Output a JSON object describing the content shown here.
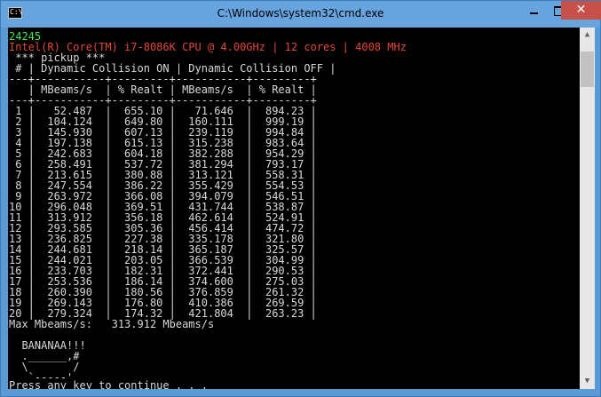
{
  "window": {
    "title": "C:\\Windows\\system32\\cmd.exe",
    "icon_label": "C:\\",
    "minimize_icon": "minimize-icon",
    "maximize_icon": "maximize-icon",
    "close_label": "✕"
  },
  "colors": {
    "titlebar": "#67a3dd",
    "console_bg": "#000000",
    "close_button": "#c7504a",
    "green": "#4be34b",
    "red": "#e2483a",
    "cyan": "#35c4d4",
    "yellow": "#ecec33",
    "text": "#c0c0c0"
  },
  "console": {
    "lines": [
      "24245",
      "Intel(R) Core(TM) i7-8086K CPU @ 4.00GHz | 12 cores | 4008 MHz",
      " *** pickup ***",
      " # | Dynamic Collision ON | Dynamic Collision OFF |",
      "---+-----------+---------+-----------+---------+",
      "   | MBeams/s  | % Realt | MBeams/s  | % Realt |",
      "---+-----------+---------+-----------+---------+",
      " 1 |   52.487  |  655.10 |   71.646  |  894.23 |",
      " 2 |  104.124  |  649.80 |  160.111  |  999.19 |",
      " 3 |  145.930  |  607.13 |  239.119  |  994.84 |",
      " 4 |  197.138  |  615.13 |  315.238  |  983.64 |",
      " 5 |  242.683  |  604.18 |  382.288  |  954.29 |",
      " 6 |  258.491  |  537.72 |  381.294  |  793.17 |",
      " 7 |  213.615  |  380.88 |  313.121  |  558.31 |",
      " 8 |  247.554  |  386.22 |  355.429  |  554.53 |",
      " 9 |  263.972  |  366.08 |  394.079  |  546.51 |",
      "10 |  296.048  |  369.51 |  431.744  |  538.87 |",
      "11 |  313.912  |  356.18 |  462.614  |  524.91 |",
      "12 |  293.585  |  305.36 |  456.414  |  474.72 |",
      "13 |  236.825  |  227.38 |  335.178  |  321.80 |",
      "14 |  244.681  |  218.14 |  365.187  |  325.57 |",
      "15 |  244.021  |  203.05 |  366.539  |  304.99 |",
      "16 |  233.703  |  182.31 |  372.441  |  290.53 |",
      "17 |  253.536  |  186.14 |  374.600  |  275.03 |",
      "18 |  260.390  |  180.56 |  376.859  |  261.32 |",
      "19 |  269.143  |  176.80 |  410.386  |  269.59 |",
      "20 |  279.324  |  174.32 |  421.804  |  263.23 |",
      "Max Mbeams/s:   313.912 Mbeams/s",
      "",
      "  BANANAA!!!",
      "  .______,#",
      "  \\       /",
      "   `-----'",
      "",
      "Press any key to continue . . ."
    ]
  }
}
